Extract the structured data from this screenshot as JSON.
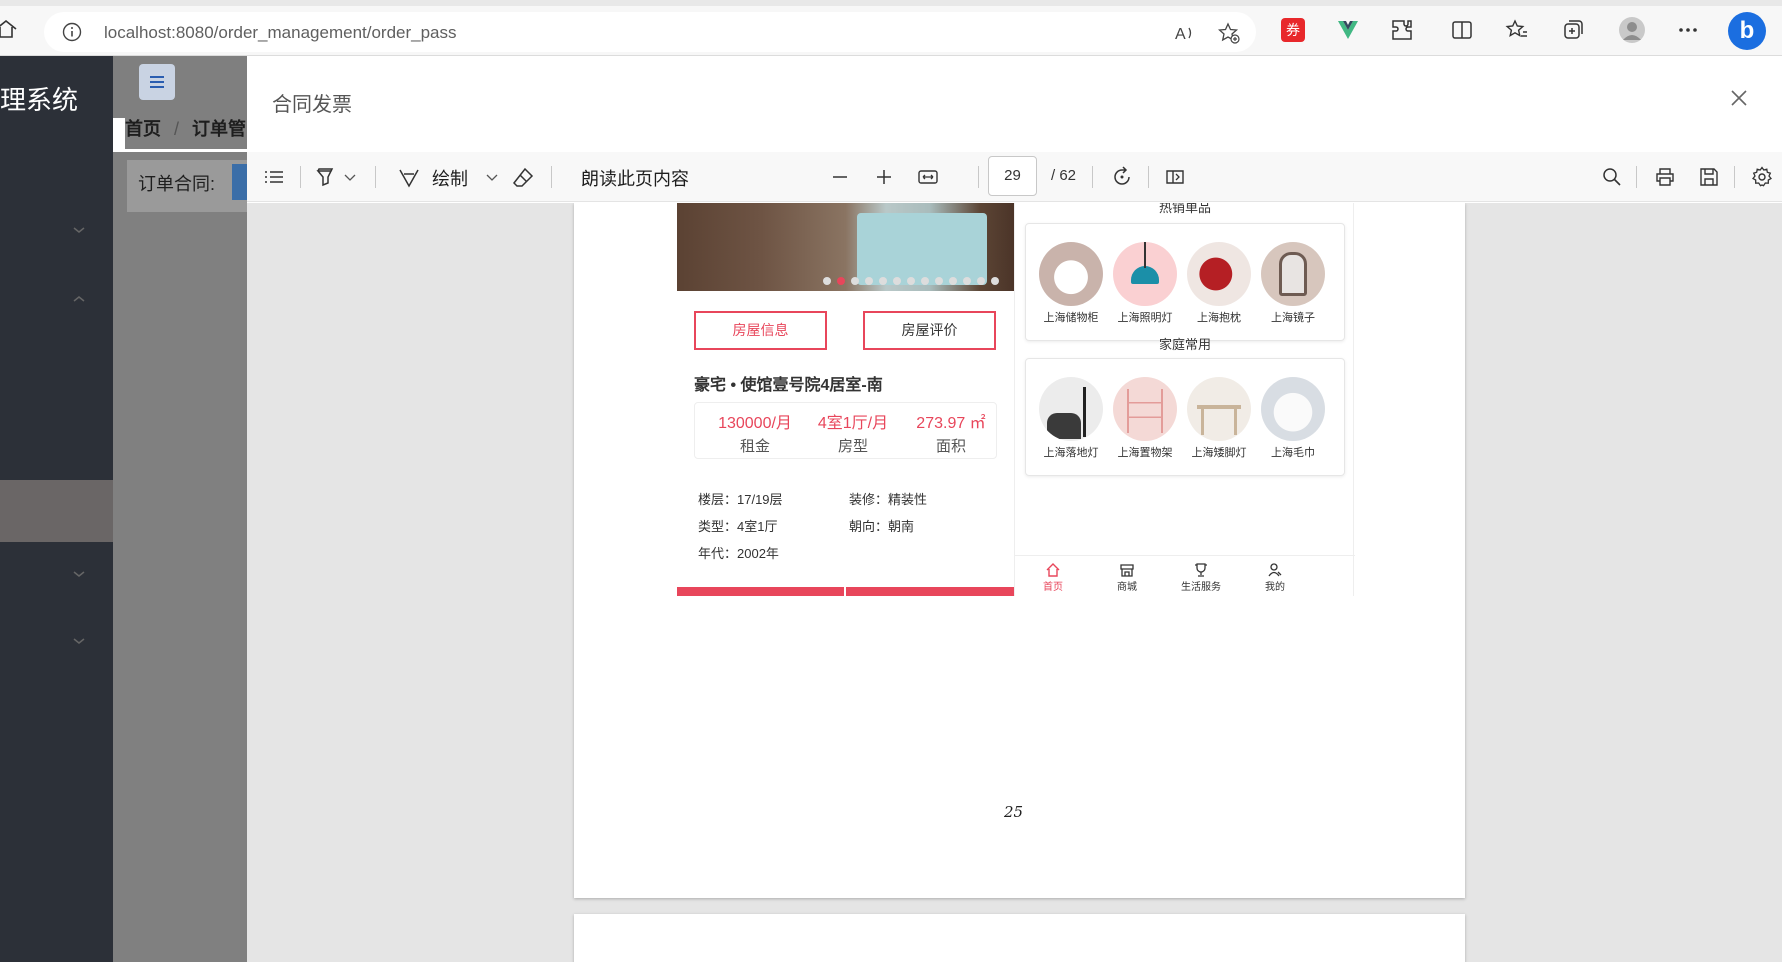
{
  "browser": {
    "url_host": "localhost",
    "url_path": ":8080/order_management/order_pass"
  },
  "app": {
    "title_fragment": "理系统",
    "breadcrumb": [
      "首页",
      "/",
      "订单管"
    ],
    "filter_label": "订单合同:"
  },
  "dialog": {
    "title": "合同发票"
  },
  "pdf_toolbar": {
    "draw_label": "绘制",
    "read_aloud_label": "朗读此页内容",
    "current_page": "29",
    "total_pages": "/ 62"
  },
  "pdf_page": {
    "page_number": "25",
    "left_panel": {
      "carousel": {
        "dot_count": 13,
        "active_index": 1
      },
      "info_button": "房屋信息",
      "review_button": "房屋评价",
      "title": "豪宅 • 使馆壹号院4居室-南",
      "stats": [
        {
          "value": "130000/月",
          "label": "租金"
        },
        {
          "value": "4室1厅/月",
          "label": "房型"
        },
        {
          "value": "273.97 ㎡",
          "label": "面积"
        }
      ],
      "details": [
        {
          "text": "楼层：17/19层"
        },
        {
          "text": "装修：精装性"
        },
        {
          "text": "类型：4室1厅"
        },
        {
          "text": "朝向：朝南"
        },
        {
          "text": "年代：2002年"
        }
      ]
    },
    "right_panel": {
      "hot_title": "热销单品",
      "hot_items": [
        "上海储物柜",
        "上海照明灯",
        "上海抱枕",
        "上海镜子"
      ],
      "home_title": "家庭常用",
      "home_items": [
        "上海落地灯",
        "上海置物架",
        "上海矮脚灯",
        "上海毛巾"
      ],
      "tabs": [
        "首页",
        "商城",
        "生活服务",
        "我的"
      ],
      "active_tab": "首页"
    }
  },
  "colors": {
    "accent": "#e8465b",
    "sidebar": "#2c3038",
    "overlay_gray": "#808080"
  }
}
